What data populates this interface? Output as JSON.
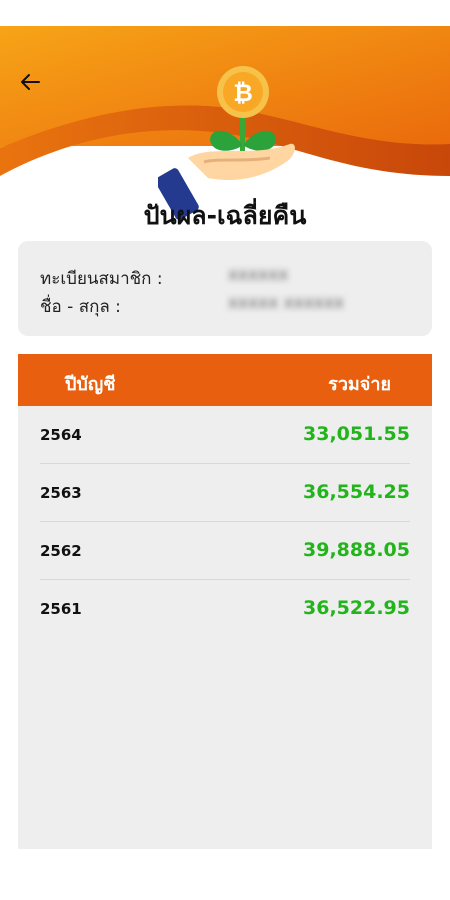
{
  "page": {
    "title": "ปันผล-เฉลี่ยคืน",
    "colors": {
      "header_orange": "#f59a12",
      "header_dark": "#d84f06",
      "table_head": "#e8600f",
      "amount_green": "#22b41b",
      "card_bg": "#eeeeee"
    }
  },
  "nav": {
    "back_icon": "arrow-left-icon"
  },
  "illustration": {
    "icons": [
      "bitcoin-coin-icon",
      "plant-icon",
      "hand-icon"
    ]
  },
  "member": {
    "registration_label": "ทะเบียนสมาชิก :",
    "registration_value": "xxxxxx",
    "name_label": "ชื่อ - สกุล :",
    "name_value": "xxxxx xxxxxx"
  },
  "table": {
    "headers": {
      "year": "ปีบัญชี",
      "total": "รวมจ่าย"
    },
    "rows": [
      {
        "year": "2564",
        "amount": "33,051.55"
      },
      {
        "year": "2563",
        "amount": "36,554.25"
      },
      {
        "year": "2562",
        "amount": "39,888.05"
      },
      {
        "year": "2561",
        "amount": "36,522.95"
      }
    ]
  }
}
